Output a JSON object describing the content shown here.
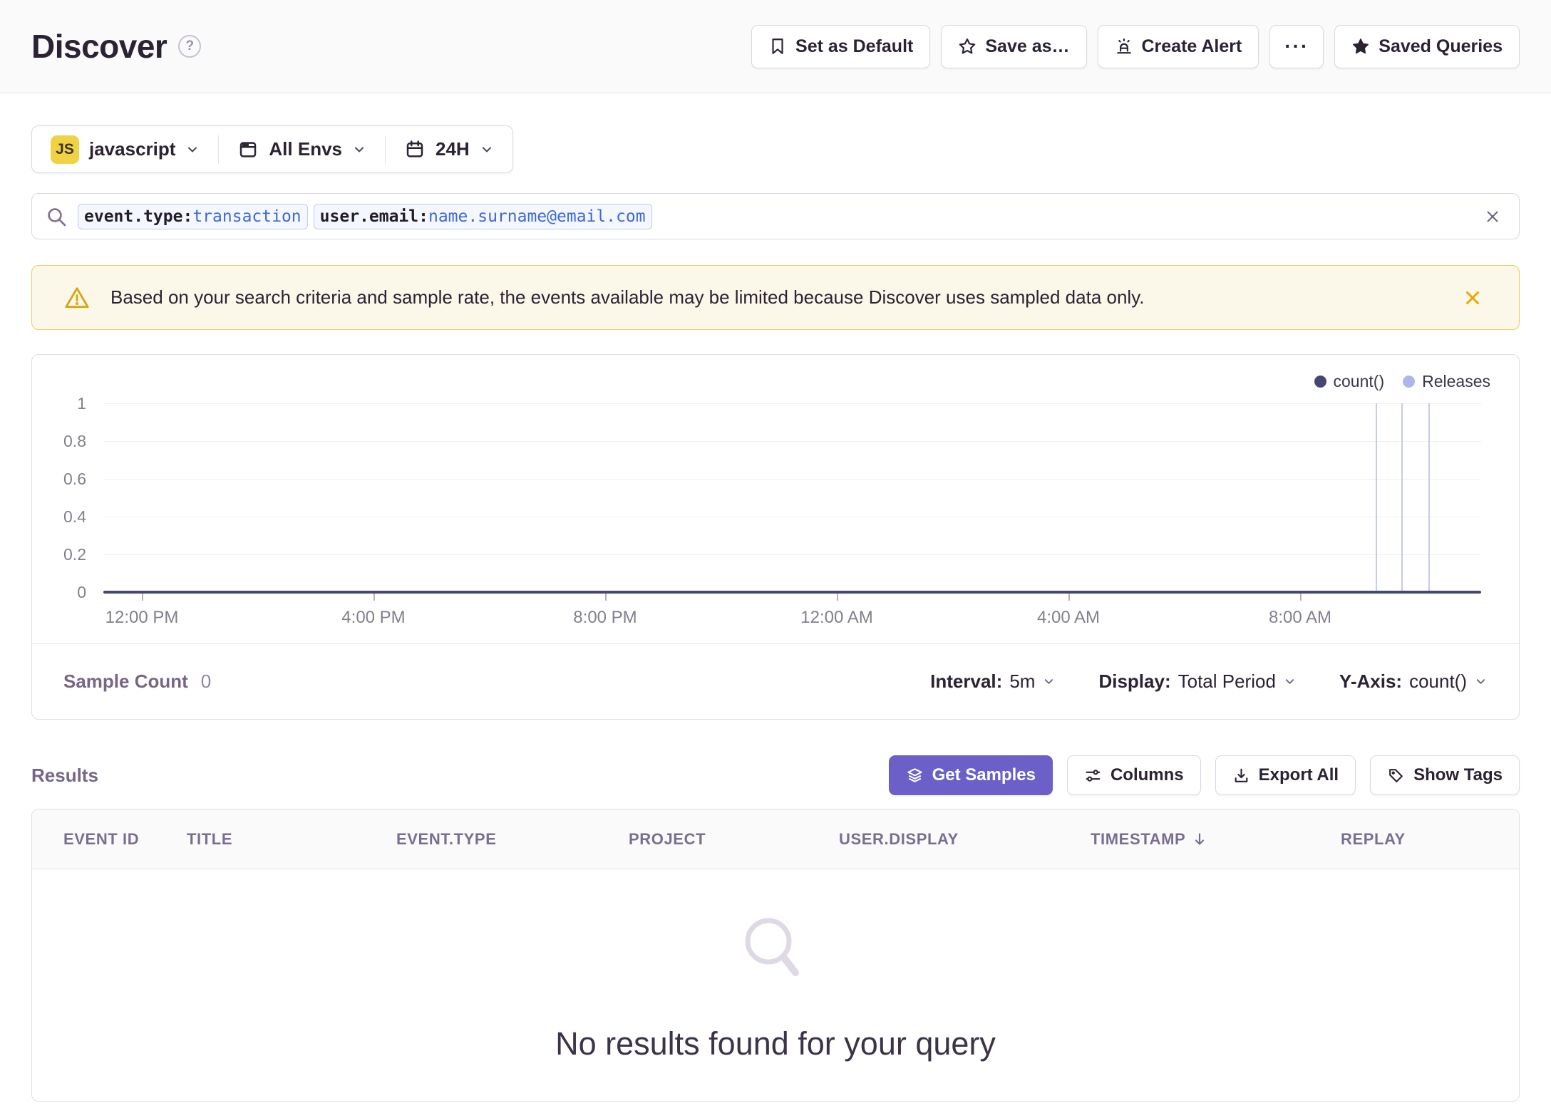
{
  "header": {
    "title": "Discover",
    "help_icon": "?",
    "actions": [
      {
        "label": "Set as Default",
        "icon": "bookmark-icon"
      },
      {
        "label": "Save as…",
        "icon": "star-outline-icon"
      },
      {
        "label": "Create Alert",
        "icon": "siren-icon"
      },
      {
        "label": "···",
        "icon": "ellipsis-icon"
      },
      {
        "label": "Saved Queries",
        "icon": "star-filled-icon"
      }
    ]
  },
  "filters": {
    "project": {
      "badge": "JS",
      "label": "javascript"
    },
    "environment": {
      "label": "All Envs"
    },
    "time_range": {
      "label": "24H"
    }
  },
  "search": {
    "tokens": [
      {
        "key": "event.type:",
        "value": "transaction"
      },
      {
        "key": "user.email:",
        "value": "name.surname@email.com"
      }
    ]
  },
  "banner": {
    "text": "Based on your search criteria and sample rate, the events available may be limited because Discover uses sampled data only."
  },
  "chart": {
    "legend": [
      {
        "label": "count()",
        "color": "#444674"
      },
      {
        "label": "Releases",
        "color": "#AEB5EC"
      }
    ],
    "yticks": [
      "1",
      "0.8",
      "0.6",
      "0.4",
      "0.2",
      "0"
    ],
    "xticks": [
      "12:00 PM",
      "4:00 PM",
      "8:00 PM",
      "12:00 AM",
      "4:00 AM",
      "8:00 AM"
    ],
    "series": [
      {
        "name": "count()",
        "type": "line",
        "flat_value": 0
      },
      {
        "name": "Releases",
        "type": "vertical-lines",
        "x_fraction": [
          0.923,
          0.942,
          0.961
        ]
      }
    ],
    "ylim": [
      0,
      1
    ]
  },
  "chart_footer": {
    "sample_count_label": "Sample Count",
    "sample_count_value": "0",
    "interval_label": "Interval:",
    "interval_value": "5m",
    "display_label": "Display:",
    "display_value": "Total Period",
    "yaxis_label": "Y-Axis:",
    "yaxis_value": "count()"
  },
  "results": {
    "heading": "Results",
    "actions": [
      {
        "label": "Get Samples",
        "icon": "layers-icon",
        "style": "primary"
      },
      {
        "label": "Columns",
        "icon": "sliders-icon"
      },
      {
        "label": "Export All",
        "icon": "download-icon"
      },
      {
        "label": "Show Tags",
        "icon": "tag-icon"
      }
    ],
    "table": {
      "columns": [
        "EVENT ID",
        "TITLE",
        "EVENT.TYPE",
        "PROJECT",
        "USER.DISPLAY",
        "TIMESTAMP",
        "REPLAY"
      ],
      "sorted_column": "TIMESTAMP",
      "sort_direction": "desc",
      "empty_message": "No results found for your query"
    }
  }
}
